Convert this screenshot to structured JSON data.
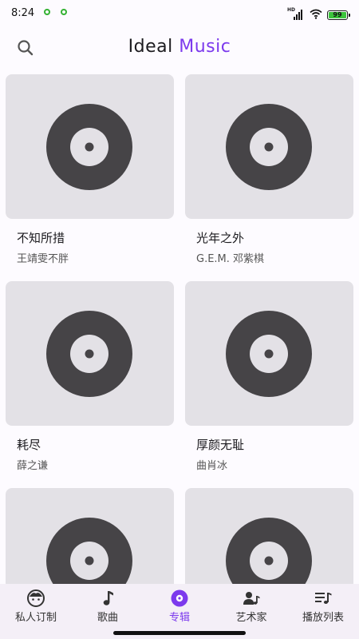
{
  "status_bar": {
    "time": "8:24",
    "network_label": "HD",
    "battery": "99",
    "battery_level": 0.99
  },
  "header": {
    "title_part1": "Ideal",
    "title_part2": "Music",
    "accent_color": "#7c3aed"
  },
  "albums": [
    {
      "title": "不知所措",
      "artist": "王靖雯不胖"
    },
    {
      "title": "光年之外",
      "artist": "G.E.M. 邓紫棋"
    },
    {
      "title": "耗尽",
      "artist": "薛之谦"
    },
    {
      "title": "厚颜无耻",
      "artist": "曲肖冰"
    },
    {
      "title": "",
      "artist": ""
    },
    {
      "title": "",
      "artist": ""
    }
  ],
  "nav": {
    "items": [
      {
        "label": "私人订制",
        "icon": "face-icon"
      },
      {
        "label": "歌曲",
        "icon": "music-note-icon"
      },
      {
        "label": "专辑",
        "icon": "album-disc-icon",
        "active": true
      },
      {
        "label": "艺术家",
        "icon": "artist-icon"
      },
      {
        "label": "播放列表",
        "icon": "playlist-icon"
      }
    ]
  }
}
